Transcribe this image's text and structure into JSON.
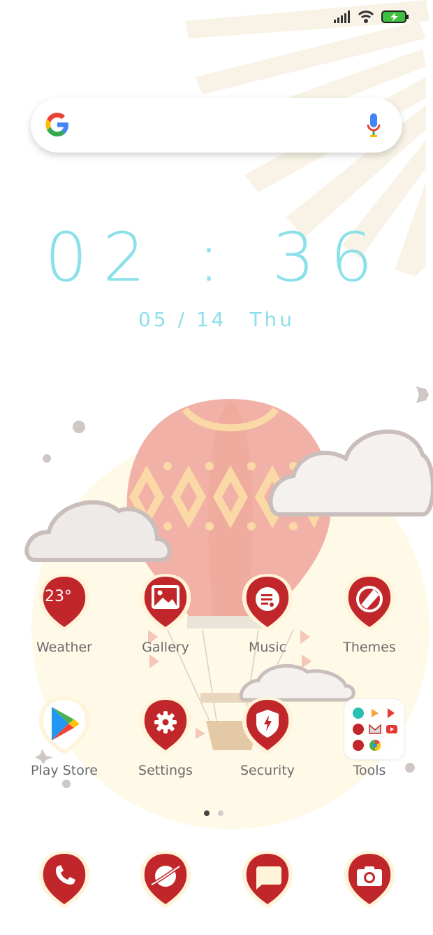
{
  "clock": {
    "time": "02 : 36",
    "date": "05 / 14",
    "day": "Thu"
  },
  "apps_row1": [
    {
      "label": "Weather",
      "badge": "23°",
      "icon": "weather-icon"
    },
    {
      "label": "Gallery",
      "icon": "gallery-icon"
    },
    {
      "label": "Music",
      "icon": "music-icon"
    },
    {
      "label": "Themes",
      "icon": "themes-icon"
    }
  ],
  "apps_row2": [
    {
      "label": "Play Store",
      "icon": "play-store-icon"
    },
    {
      "label": "Settings",
      "icon": "gear-icon"
    },
    {
      "label": "Security",
      "icon": "shield-icon"
    },
    {
      "label": "Tools",
      "icon": "folder-icon"
    }
  ],
  "dock": [
    {
      "icon": "phone-icon"
    },
    {
      "icon": "browser-icon"
    },
    {
      "icon": "messages-icon"
    },
    {
      "icon": "camera-icon"
    }
  ],
  "colors": {
    "accent": "#c0262a",
    "clock": "#8be0ea",
    "balloon": "#f2b1a6"
  }
}
